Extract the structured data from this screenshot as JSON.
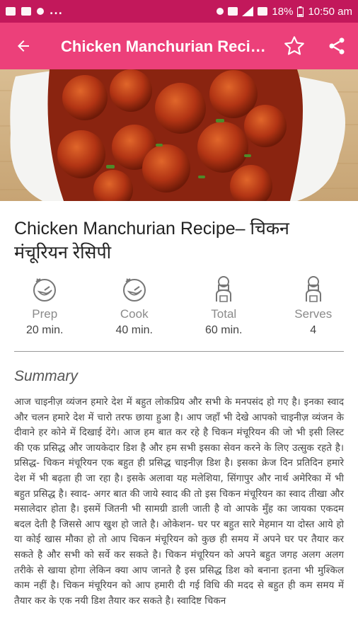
{
  "status_bar": {
    "battery": "18%",
    "time": "10:50 am",
    "overflow": "..."
  },
  "app_bar": {
    "title": "Chicken Manchurian Recipe– चिकन मंचूरियन रेसिपी",
    "back_icon": "arrow-left-icon",
    "favorite_icon": "star-outline-icon",
    "share_icon": "share-icon"
  },
  "hero": {
    "image_name": "chicken-manchurian-photo"
  },
  "recipe": {
    "title": "Chicken Manchurian Recipe– चिकन मंचूरियन रेसिपी",
    "stats": [
      {
        "label": "Prep",
        "value": "20 min.",
        "icon": "timer-icon"
      },
      {
        "label": "Cook",
        "value": "40 min.",
        "icon": "timer-icon"
      },
      {
        "label": "Total",
        "value": "60 min.",
        "icon": "chef-icon"
      },
      {
        "label": "Serves",
        "value": "4",
        "icon": "chef-icon"
      }
    ],
    "summary_heading": "Summary",
    "summary_text": "आज चाइनीज़ व्यंजन हमारे देश में बहुत लोकप्रिय और सभी के मनपसंद हो गए है। इनका स्वाद और चलन हमारे देश में चारो तरफ छाया हुआ है। आप जहाँ भी देखे आपको चाइनीज़ व्यंजन के दीवाने हर कोने में दिखाई देंगे। आज हम बात कर रहे है चिकन मंचूरियन की जो भी इसी लिस्ट की एक प्रसिद्ध और जायकेदार डिश है और हम सभी इसका सेवन करने के लिए उत्सुक रहते है।  प्रसिद्ध- चिकन मंचूरियन एक बहुत ही प्रसिद्ध चाइनीज़ डिश है। इसका क्रेज दिन प्रतिदिन हमारे देश में भी बढ़ता ही जा रहा है। इसके अलावा यह मलेशिया, सिंगापुर और नार्थ अमेरिका में भी बहुत प्रसिद्ध है।  स्वाद- अगर बात की जाये स्वाद की तो इस चिकन मंचूरियन का स्वाद तीखा और मसालेदार होता है। इसमें जितनी भी सामग्री डाली जाती है वो आपके मुँह का जायका एकदम बदल देती है जिससे आप खुश हो जाते है।  ओकेशन- घर पर बहुत सारे मेहमान या दोस्त आये हो या कोई खास मौका हो तो आप चिकन मंचूरियन को कुछ ही समय में अपने घर पर तैयार कर सकते है और सभी को सर्वे कर सकते है।  चिकन मंचूरियन को अपने बहुत जगह अलग अलग तरीके से खाया होगा लेकिन क्या आप जानते है इस प्रसिद्ध डिश को बनाना इतना भी मुश्किल काम नहीं है। चिकन मंचूरियन को आप हमारी दी गई विधि की मदद से बहुत ही कम समय में तैयार कर के एक नयी डिश तैयार कर सकते है।  स्वादिष्ट चिकन"
  },
  "colors": {
    "status_bar": "#c2185b",
    "app_bar": "#ec407a",
    "icon_gray": "#777777"
  }
}
